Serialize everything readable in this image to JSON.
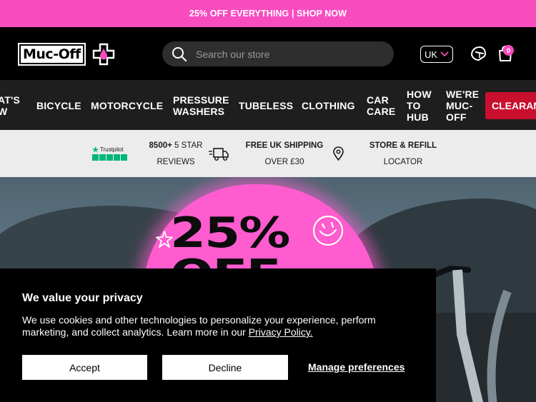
{
  "promo": {
    "text": "25% OFF EVERYTHING | SHOP NOW"
  },
  "header": {
    "logo_text": "Muc-Off",
    "search_placeholder": "Search our store",
    "region": "UK",
    "cart_count": "0"
  },
  "nav": {
    "items": [
      {
        "label": "AT'S\nW"
      },
      {
        "label": "BICYCLE"
      },
      {
        "label": "MOTORCYCLE"
      },
      {
        "label": "PRESSURE\nWASHERS"
      },
      {
        "label": "TUBELESS"
      },
      {
        "label": "CLOTHING"
      },
      {
        "label": "CAR\nCARE"
      },
      {
        "label": "HOW\nTO\nHUB"
      },
      {
        "label": "WE'RE\nMUC-\nOFF"
      },
      {
        "label": "CLEARAN"
      }
    ]
  },
  "usp": {
    "trustpilot_label": "Trustpilot",
    "reviews_count": "8500+",
    "reviews_line1_rest": " 5 STAR",
    "reviews_line2": "REVIEWS",
    "shipping_line1": "FREE UK SHIPPING",
    "shipping_line2": "OVER £30",
    "store_line1": "STORE & REFILL",
    "store_line2": "LOCATOR"
  },
  "hero": {
    "sale_line1": "25%",
    "sale_line2": "OFF"
  },
  "cookie": {
    "title": "We value your privacy",
    "body": "We use cookies and other technologies to personalize your experience, perform marketing, and collect analytics. Learn more in our ",
    "link": "Privacy Policy.",
    "accept": "Accept",
    "decline": "Decline",
    "manage": "Manage preferences"
  },
  "colors": {
    "brand_pink": "#f84cbf",
    "clearance_red": "#c8102e",
    "nav_bg": "#1e1e1e",
    "trustpilot_green": "#00b67a"
  }
}
